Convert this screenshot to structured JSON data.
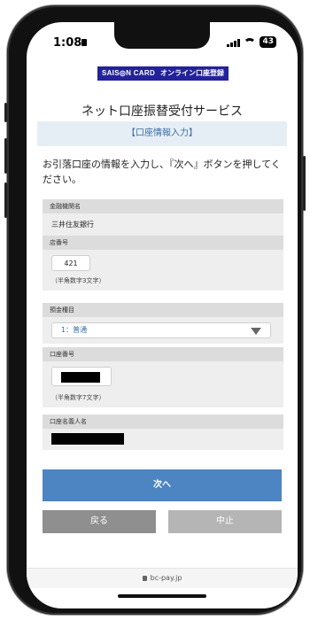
{
  "status_bar": {
    "time": "1:08",
    "battery": "43"
  },
  "header": {
    "brand": "SAIS◎N CARD",
    "registration": "オンライン口座登録"
  },
  "page": {
    "title": "ネット口座振替受付サービス",
    "section": "【口座情報入力】",
    "instruction": "お引落口座の情報を入力し、『次へ』ボタンを押してください。"
  },
  "form": {
    "bank": {
      "label": "金融機関名",
      "value": "三井住友銀行"
    },
    "branch": {
      "label": "店番号",
      "value": "421",
      "hint": "（半角数字3文字）"
    },
    "account_type": {
      "label": "預金種目",
      "value": "1：普通"
    },
    "account_number": {
      "label": "口座番号",
      "hint": "（半角数字7文字）"
    },
    "account_holder": {
      "label": "口座名義人名"
    }
  },
  "buttons": {
    "next": "次へ",
    "back": "戻る",
    "cancel": "中止"
  },
  "browser": {
    "url": "bc-pay.jp"
  }
}
